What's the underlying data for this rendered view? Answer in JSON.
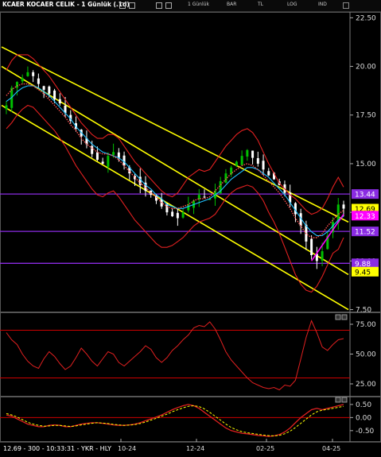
{
  "window": {
    "title": "KCAER KOCAER CELIK - 1 Günlük (.1d)",
    "toolbar_items": [
      "1 Günlük",
      "BAR",
      "TL",
      "LOG",
      "IND"
    ]
  },
  "status": {
    "text": "12.69 - 300 - 10:33:31 - YKR - HLY"
  },
  "colors": {
    "up_candle": "#00c000",
    "down_candle": "#ffffff",
    "bollinger": "#e02020",
    "ma_fast": "#20c0ff",
    "ma_dotted": "#ff5050",
    "channel": "#ffff00",
    "level_line": "#8a2be2",
    "rsi": "#e02020",
    "macd_signal": "#ffff00"
  },
  "chart_data": [
    {
      "type": "candlestick",
      "name": "price",
      "yticks": [
        "22.50",
        "20.00",
        "17.50",
        "15.00",
        "12.50",
        "10.00",
        "7.50"
      ],
      "ylim": [
        7.4,
        22.8
      ],
      "x_tick_labels": [
        "10-24",
        "12-24",
        "02-25",
        "04-25"
      ],
      "horizontal_levels": [
        13.44,
        11.52,
        9.88
      ],
      "price_tags": [
        {
          "label": "13.44",
          "value": 13.44,
          "bg": "#8a2be2",
          "fg": "#fff"
        },
        {
          "label": "12.69",
          "value": 12.69,
          "bg": "#ffff00",
          "fg": "#000"
        },
        {
          "label": "12.33",
          "value": 12.33,
          "bg": "#ff00ff",
          "fg": "#fff"
        },
        {
          "label": "11.52",
          "value": 11.52,
          "bg": "#8a2be2",
          "fg": "#fff"
        },
        {
          "label": "9.88",
          "value": 9.88,
          "bg": "#8a2be2",
          "fg": "#fff"
        },
        {
          "label": "9.45",
          "value": 9.45,
          "bg": "#ffff00",
          "fg": "#000"
        }
      ],
      "last_close": 12.69,
      "channel_lines": [
        {
          "x0": 0,
          "y0": 21.0,
          "x1": 1,
          "y1": 12.0
        },
        {
          "x0": 0,
          "y0": 20.0,
          "x1": 1,
          "y1": 9.3
        },
        {
          "x0": 0,
          "y0": 18.0,
          "x1": 1,
          "y1": 7.5
        }
      ],
      "close": [
        18.0,
        18.9,
        19.2,
        19.4,
        19.7,
        19.5,
        19.1,
        18.8,
        18.6,
        18.3,
        18.1,
        17.6,
        17.2,
        16.8,
        16.4,
        16.0,
        15.5,
        15.2,
        15.0,
        15.4,
        15.6,
        15.3,
        14.9,
        14.5,
        14.2,
        13.9,
        13.6,
        13.4,
        13.1,
        12.8,
        12.5,
        12.3,
        12.2,
        12.5,
        12.9,
        13.1,
        13.4,
        13.3,
        13.2,
        13.6,
        14.1,
        14.5,
        14.8,
        15.1,
        15.4,
        15.7,
        15.3,
        15.0,
        14.7,
        14.4,
        14.2,
        13.9,
        13.5,
        13.0,
        12.4,
        11.8,
        11.0,
        10.3,
        10.0,
        10.5,
        11.3,
        12.0,
        12.9,
        12.69
      ],
      "bb_upper": [
        19.8,
        20.3,
        20.6,
        20.6,
        20.6,
        20.4,
        20.1,
        19.8,
        19.5,
        19.1,
        18.7,
        18.3,
        17.9,
        17.5,
        17.1,
        16.8,
        16.5,
        16.3,
        16.3,
        16.5,
        16.5,
        16.3,
        15.9,
        15.5,
        15.1,
        14.8,
        14.5,
        14.2,
        13.9,
        13.6,
        13.4,
        13.3,
        13.5,
        13.9,
        14.3,
        14.5,
        14.7,
        14.6,
        14.7,
        15.1,
        15.5,
        15.9,
        16.2,
        16.5,
        16.7,
        16.8,
        16.6,
        16.2,
        15.6,
        15.0,
        14.5,
        14.0,
        13.7,
        13.4,
        13.2,
        12.9,
        12.6,
        12.4,
        12.5,
        12.7,
        13.2,
        13.8,
        14.3,
        13.8
      ],
      "bb_lower": [
        16.8,
        17.1,
        17.5,
        17.8,
        18.0,
        17.9,
        17.6,
        17.3,
        17.0,
        16.7,
        16.3,
        15.9,
        15.4,
        14.9,
        14.5,
        14.1,
        13.7,
        13.4,
        13.3,
        13.5,
        13.6,
        13.3,
        12.9,
        12.5,
        12.1,
        11.8,
        11.5,
        11.2,
        10.9,
        10.7,
        10.7,
        10.8,
        11.0,
        11.2,
        11.5,
        11.8,
        12.0,
        12.1,
        12.2,
        12.4,
        12.8,
        13.2,
        13.5,
        13.7,
        13.8,
        13.9,
        13.8,
        13.5,
        13.1,
        12.5,
        12.0,
        11.4,
        10.7,
        10.0,
        9.3,
        8.8,
        8.5,
        8.4,
        8.7,
        9.2,
        9.8,
        10.4,
        10.6,
        11.2
      ],
      "ma_fast": [
        18.5,
        18.8,
        19.0,
        19.1,
        19.1,
        19.0,
        18.8,
        18.6,
        18.3,
        18.0,
        17.7,
        17.4,
        17.0,
        16.7,
        16.3,
        16.0,
        15.8,
        15.6,
        15.5,
        15.5,
        15.4,
        15.2,
        14.9,
        14.6,
        14.3,
        14.0,
        13.8,
        13.5,
        13.3,
        13.0,
        12.8,
        12.7,
        12.7,
        12.8,
        12.9,
        13.1,
        13.2,
        13.2,
        13.3,
        13.6,
        13.9,
        14.2,
        14.5,
        14.7,
        14.9,
        15.0,
        14.9,
        14.7,
        14.4,
        14.1,
        13.8,
        13.5,
        13.1,
        12.7,
        12.2,
        11.8,
        11.4,
        11.2,
        11.2,
        11.4,
        11.8,
        12.1,
        12.4,
        12.6
      ],
      "ma_slow": [
        18.2,
        18.4,
        18.7,
        18.9,
        19.0,
        19.0,
        18.9,
        18.7,
        18.5,
        18.2,
        17.9,
        17.6,
        17.3,
        16.9,
        16.6,
        16.3,
        16.0,
        15.8,
        15.6,
        15.5,
        15.4,
        15.3,
        15.1,
        14.8,
        14.5,
        14.2,
        13.9,
        13.7,
        13.4,
        13.2,
        12.9,
        12.8,
        12.7,
        12.7,
        12.8,
        12.9,
        13.0,
        13.1,
        13.2,
        13.4,
        13.6,
        13.9,
        14.2,
        14.4,
        14.6,
        14.8,
        14.8,
        14.7,
        14.5,
        14.3,
        14.0,
        13.7,
        13.4,
        13.0,
        12.6,
        12.2,
        11.8,
        11.5,
        11.3,
        11.3,
        11.5,
        11.8,
        12.1,
        12.3
      ]
    },
    {
      "type": "line",
      "name": "rsi",
      "yticks": [
        "75.00",
        "50.00",
        "25.00"
      ],
      "ylim": [
        15,
        85
      ],
      "reference_lines": [
        70,
        30
      ],
      "values": [
        68,
        62,
        58,
        50,
        44,
        40,
        38,
        46,
        52,
        48,
        42,
        37,
        40,
        47,
        55,
        50,
        44,
        40,
        46,
        52,
        50,
        43,
        40,
        44,
        48,
        52,
        57,
        54,
        47,
        43,
        47,
        53,
        57,
        62,
        66,
        72,
        74,
        73,
        77,
        71,
        62,
        52,
        45,
        40,
        35,
        30,
        26,
        24,
        22,
        21,
        22,
        20,
        24,
        23,
        28,
        46,
        64,
        78,
        68,
        56,
        53,
        58,
        62,
        63
      ]
    },
    {
      "type": "line",
      "name": "macd",
      "yticks": [
        "0.50",
        "0.00",
        "-0.50"
      ],
      "ylim": [
        -0.9,
        0.8
      ],
      "reference_lines": [
        0
      ],
      "macd": [
        0.1,
        0.05,
        -0.05,
        -0.15,
        -0.25,
        -0.3,
        -0.35,
        -0.35,
        -0.3,
        -0.28,
        -0.3,
        -0.35,
        -0.35,
        -0.3,
        -0.25,
        -0.22,
        -0.2,
        -0.2,
        -0.22,
        -0.25,
        -0.28,
        -0.3,
        -0.3,
        -0.28,
        -0.25,
        -0.2,
        -0.12,
        -0.05,
        0.02,
        0.1,
        0.2,
        0.3,
        0.38,
        0.45,
        0.5,
        0.45,
        0.35,
        0.2,
        0.05,
        -0.1,
        -0.25,
        -0.4,
        -0.5,
        -0.55,
        -0.6,
        -0.62,
        -0.65,
        -0.68,
        -0.7,
        -0.72,
        -0.7,
        -0.65,
        -0.55,
        -0.4,
        -0.2,
        0.0,
        0.15,
        0.3,
        0.35,
        0.3,
        0.35,
        0.4,
        0.45,
        0.5
      ],
      "signal": [
        0.15,
        0.1,
        0.02,
        -0.08,
        -0.18,
        -0.25,
        -0.3,
        -0.33,
        -0.32,
        -0.3,
        -0.3,
        -0.32,
        -0.34,
        -0.32,
        -0.28,
        -0.25,
        -0.22,
        -0.2,
        -0.21,
        -0.23,
        -0.26,
        -0.28,
        -0.3,
        -0.29,
        -0.27,
        -0.23,
        -0.17,
        -0.1,
        -0.03,
        0.05,
        0.13,
        0.22,
        0.3,
        0.37,
        0.43,
        0.45,
        0.42,
        0.33,
        0.2,
        0.05,
        -0.1,
        -0.25,
        -0.38,
        -0.47,
        -0.54,
        -0.58,
        -0.61,
        -0.64,
        -0.67,
        -0.69,
        -0.7,
        -0.68,
        -0.62,
        -0.52,
        -0.38,
        -0.22,
        -0.06,
        0.1,
        0.22,
        0.28,
        0.31,
        0.35,
        0.39,
        0.43
      ]
    }
  ]
}
